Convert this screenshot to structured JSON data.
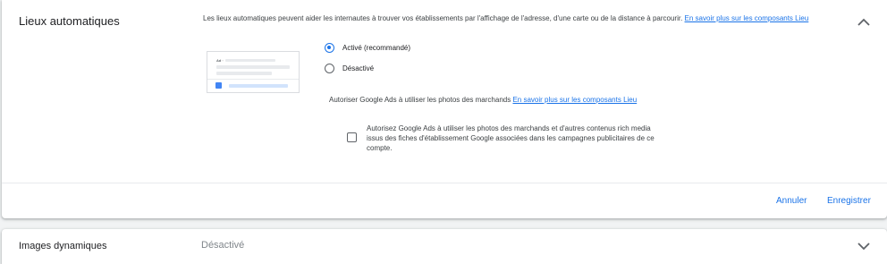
{
  "section_auto_locations": {
    "title": "Lieux automatiques",
    "description": "Les lieux automatiques peuvent aider les internautes à trouver vos établissements par l'affichage de l'adresse, d'une carte ou de la distance à parcourir.",
    "description_link": "En savoir plus sur les composants Lieu",
    "collapse_icon": "chevron-up-icon",
    "preview": {
      "ad_label": "Ad ·",
      "pin_icon": "location-pin-icon"
    },
    "options": [
      {
        "label": "Activé (recommandé)",
        "selected": true
      },
      {
        "label": "Désactivé",
        "selected": false
      }
    ],
    "photos": {
      "label": "Autoriser Google Ads à utiliser les photos des marchands",
      "link": "En savoir plus sur les composants Lieu",
      "checkbox_label": "Autorisez Google Ads à utiliser les photos des marchands et d'autres contenus rich media issus des fiches d'établissement Google associées dans les campagnes publicitaires de ce compte.",
      "checked": false
    },
    "actions": {
      "cancel": "Annuler",
      "save": "Enregistrer"
    }
  },
  "section_dynamic_images": {
    "title": "Images dynamiques",
    "value": "Désactivé",
    "expand_icon": "chevron-down-icon"
  },
  "colors": {
    "accent": "#1a73e8",
    "background": "#f1f3f4",
    "panel": "#ffffff"
  }
}
